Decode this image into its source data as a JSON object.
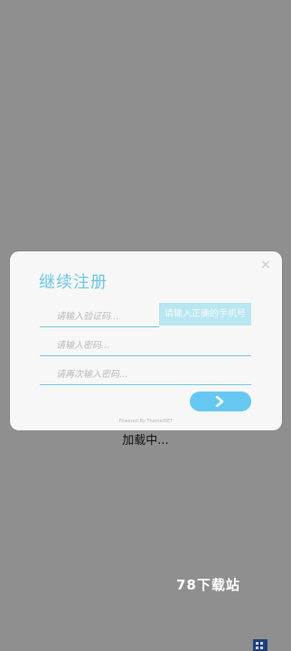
{
  "dialog": {
    "title": "继续注册",
    "close_label": "×",
    "fields": {
      "code_placeholder": "请输入验证码...",
      "password_placeholder": "请输入密码...",
      "password_confirm_placeholder": "请再次输入密码..."
    },
    "send_code_label": "请输入正确的手机号",
    "next_icon": "chevron-right-icon",
    "powered_by": "Powered By Theme/NET"
  },
  "loading_text": "加载中...",
  "watermark": "78下载站",
  "colors": {
    "overlay": "#8f8f8f",
    "dialog_bg": "#f7f7f7",
    "accent": "#6bc8de",
    "button": "#66c8f0",
    "send_code_bg": "#b8e6f1"
  }
}
